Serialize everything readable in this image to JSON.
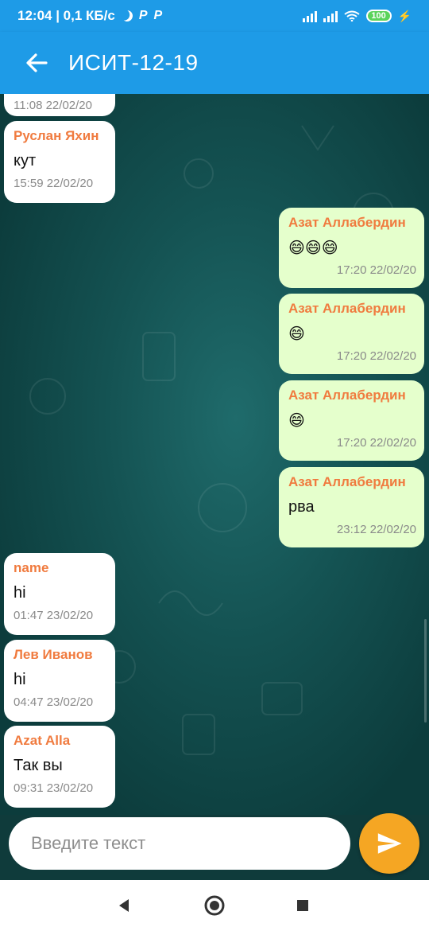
{
  "status_bar": {
    "time_speed": "12:04 | 0,1 КБ/с",
    "p_icon_1": "P",
    "p_icon_2": "P",
    "battery": "100"
  },
  "app_bar": {
    "title": "ИСИТ-12-19"
  },
  "messages": [
    {
      "direction": "in",
      "sender": "",
      "text": "",
      "time": "11:08 22/02/20"
    },
    {
      "direction": "in",
      "sender": "Руслан Яхин",
      "text": "кут",
      "time": "15:59 22/02/20"
    },
    {
      "direction": "out",
      "sender": "Азат Аллабердин",
      "text": "😄😄😄",
      "time": "17:20 22/02/20"
    },
    {
      "direction": "out",
      "sender": "Азат Аллабердин",
      "text": "😄",
      "time": "17:20 22/02/20"
    },
    {
      "direction": "out",
      "sender": "Азат Аллабердин",
      "text": "😄",
      "time": "17:20 22/02/20"
    },
    {
      "direction": "out",
      "sender": "Азат Аллабердин",
      "text": "рва",
      "time": "23:12 22/02/20"
    },
    {
      "direction": "in",
      "sender": "name",
      "text": "hi",
      "time": "01:47 23/02/20"
    },
    {
      "direction": "in",
      "sender": "Лев Иванов",
      "text": "hi",
      "time": "04:47 23/02/20"
    },
    {
      "direction": "in",
      "sender": "Azat Alla",
      "text": "Так вы",
      "time": "09:31 23/02/20"
    }
  ],
  "input": {
    "placeholder": "Введите текст",
    "value": ""
  },
  "colors": {
    "app_bar": "#1e9be7",
    "sender_name": "#f07b3f",
    "outgoing_bubble": "#e5ffcc",
    "incoming_bubble": "#ffffff",
    "send_button": "#f5a623"
  },
  "icons": {
    "back": "arrow-left-icon",
    "send": "send-icon",
    "nav_back": "triangle-back-icon",
    "nav_home": "circle-home-icon",
    "nav_recents": "square-recents-icon"
  }
}
